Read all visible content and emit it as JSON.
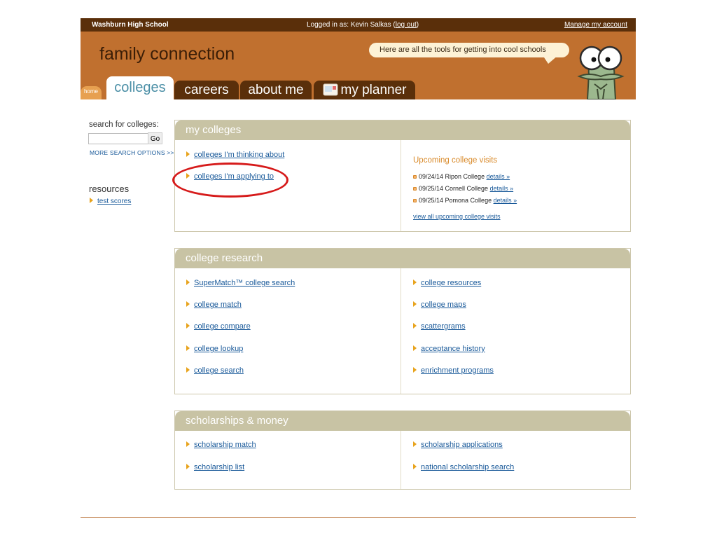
{
  "topbar": {
    "school": "Washburn High School",
    "login_prefix": "Logged in as: Kevin Salkas (",
    "logout": "log out",
    "login_suffix": ")",
    "manage": "Manage my account"
  },
  "banner": {
    "title": "family connection",
    "speech": "Here are all the tools for getting into cool schools",
    "mascot": "crocodile-mascot-icon"
  },
  "tabs": {
    "home": "home",
    "colleges": "colleges",
    "careers": "careers",
    "about": "about me",
    "planner": "my planner",
    "planner_icon": "planner-envelope-icon"
  },
  "sidebar": {
    "search_label": "search for colleges:",
    "search_value": "",
    "go": "Go",
    "more": "MORE SEARCH OPTIONS >>",
    "resources_title": "resources",
    "resources": [
      "test scores"
    ]
  },
  "my_colleges": {
    "title": "my colleges",
    "links": [
      "colleges I'm thinking about",
      "colleges I'm applying to"
    ],
    "visits_title": "Upcoming college visits",
    "visits": [
      {
        "text": "09/24/14 Ripon College",
        "link": "details »"
      },
      {
        "text": "09/25/14 Cornell College",
        "link": "details »"
      },
      {
        "text": "09/25/14 Pomona College",
        "link": "details »"
      }
    ],
    "view_all": "view all upcoming college visits"
  },
  "college_research": {
    "title": "college research",
    "left": [
      "SuperMatch™ college search",
      "college match",
      "college compare",
      "college lookup",
      "college search"
    ],
    "right": [
      "college resources",
      "college maps",
      "scattergrams",
      "acceptance history",
      "enrichment programs"
    ]
  },
  "scholarships": {
    "title": "scholarships & money",
    "left": [
      "scholarship match",
      "scholarship list"
    ],
    "right": [
      "scholarship applications",
      "national scholarship search"
    ]
  },
  "colors": {
    "brown_dark": "#5a2f0a",
    "orange": "#c0702f",
    "panel_head": "#c8c3a4",
    "link": "#1a5a9a",
    "highlight": "#d61a1a"
  }
}
